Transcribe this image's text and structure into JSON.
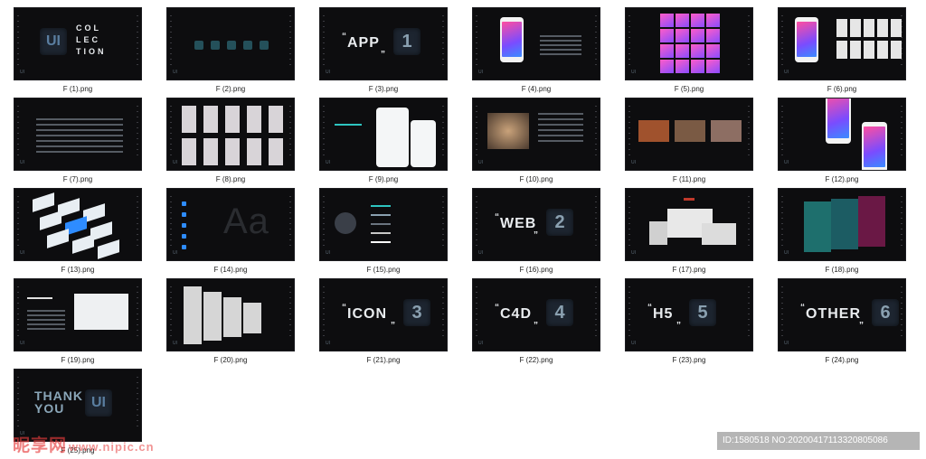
{
  "files": [
    {
      "name": "F (1).png",
      "kind": "cover",
      "label": "COL LEC TION",
      "badge": "UI"
    },
    {
      "name": "F (2).png",
      "kind": "icons"
    },
    {
      "name": "F (3).png",
      "kind": "section",
      "label": "APP",
      "num": "1"
    },
    {
      "name": "F (4).png",
      "kind": "phone-detail"
    },
    {
      "name": "F (5).png",
      "kind": "mosaic"
    },
    {
      "name": "F (6).png",
      "kind": "phone-cards"
    },
    {
      "name": "F (7).png",
      "kind": "table"
    },
    {
      "name": "F (8).png",
      "kind": "cards-grid"
    },
    {
      "name": "F (9).png",
      "kind": "app-phones"
    },
    {
      "name": "F (10).png",
      "kind": "photo-text"
    },
    {
      "name": "F (11).png",
      "kind": "three-photos"
    },
    {
      "name": "F (12).png",
      "kind": "two-phones"
    },
    {
      "name": "F (13).png",
      "kind": "iso-screens"
    },
    {
      "name": "F (14).png",
      "kind": "typography",
      "label": "Aa"
    },
    {
      "name": "F (15).png",
      "kind": "color-bars"
    },
    {
      "name": "F (16).png",
      "kind": "section",
      "label": "WEB",
      "num": "2"
    },
    {
      "name": "F (17).png",
      "kind": "devices"
    },
    {
      "name": "F (18).png",
      "kind": "color-panels"
    },
    {
      "name": "F (19).png",
      "kind": "web-monitor"
    },
    {
      "name": "F (20).png",
      "kind": "web-pages"
    },
    {
      "name": "F (21).png",
      "kind": "section",
      "label": "ICON",
      "num": "3"
    },
    {
      "name": "F (22).png",
      "kind": "section",
      "label": "C4D",
      "num": "4"
    },
    {
      "name": "F (23).png",
      "kind": "section",
      "label": "H5",
      "num": "5"
    },
    {
      "name": "F (24).png",
      "kind": "section",
      "label": "OTHER",
      "num": "6"
    },
    {
      "name": "F (25).png",
      "kind": "thanks",
      "label": "THANK YOU",
      "badge": "UI"
    }
  ],
  "watermark": {
    "brand": "昵享网",
    "url": "www.nipic.cn"
  },
  "id_bar": "ID:1580518 NO:20200417113320805086",
  "colors": {
    "tile_bg": "#0d0d0f",
    "accent": "#2ec4c0",
    "phone_gradient": [
      "#ff4fa0",
      "#7a4cff",
      "#3a8cff"
    ]
  }
}
